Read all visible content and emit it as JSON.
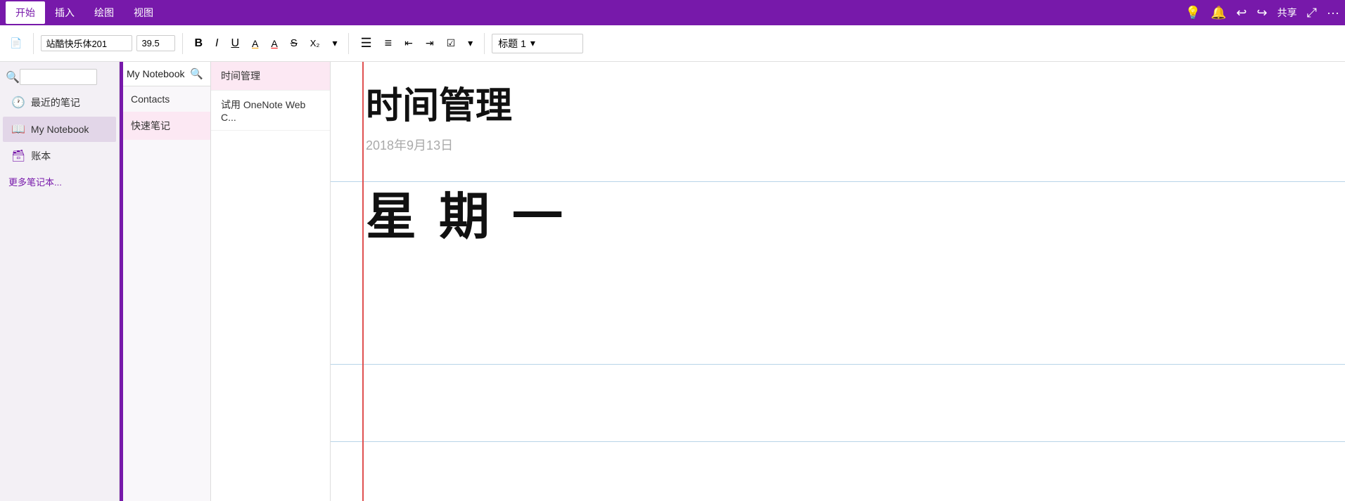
{
  "ribbon": {
    "tabs": [
      {
        "label": "开始",
        "active": true
      },
      {
        "label": "插入",
        "active": false
      },
      {
        "label": "绘图",
        "active": false
      },
      {
        "label": "视图",
        "active": false
      }
    ],
    "right_icons": [
      "💡",
      "🔔",
      "↩",
      "↪",
      "共享",
      "⤢",
      "···"
    ]
  },
  "toolbar": {
    "new_page_icon": "📄",
    "font_name": "站酷快乐体201",
    "font_size": "39.5",
    "bold_label": "B",
    "italic_label": "I",
    "underline_label": "U",
    "highlight_label": "A",
    "font_color_label": "A",
    "strikethrough_label": "S",
    "subscript_label": "X₂",
    "dropdown_arrow": "▾",
    "bullet_list_icon": "☰",
    "numbered_list_icon": "☰",
    "decrease_indent_icon": "⇤",
    "increase_indent_icon": "⇥",
    "checkbox_icon": "☑",
    "more_icon": "▾",
    "style_label": "标题 1",
    "style_arrow": "▾"
  },
  "sidebar": {
    "search_placeholder": "",
    "items": [
      {
        "id": "recent",
        "icon": "🕐",
        "label": "最近的笔记"
      },
      {
        "id": "mynotebook",
        "icon": "📖",
        "label": "My Notebook",
        "active": true
      },
      {
        "id": "accounts",
        "icon": "🗃",
        "label": "账本"
      }
    ],
    "more_label": "更多笔记本..."
  },
  "sections_panel": {
    "notebook_name": "My Notebook",
    "search_icon": "🔍",
    "items": [
      {
        "label": "Contacts",
        "active": false
      },
      {
        "label": "快速笔记",
        "active": true
      }
    ]
  },
  "pages_panel": {
    "items": [
      {
        "label": "时间管理",
        "active": true
      },
      {
        "label": "试用 OneNote Web C..."
      }
    ]
  },
  "content": {
    "title": "时间管理",
    "date": "2018年9月13日",
    "body": "星 期 一"
  }
}
